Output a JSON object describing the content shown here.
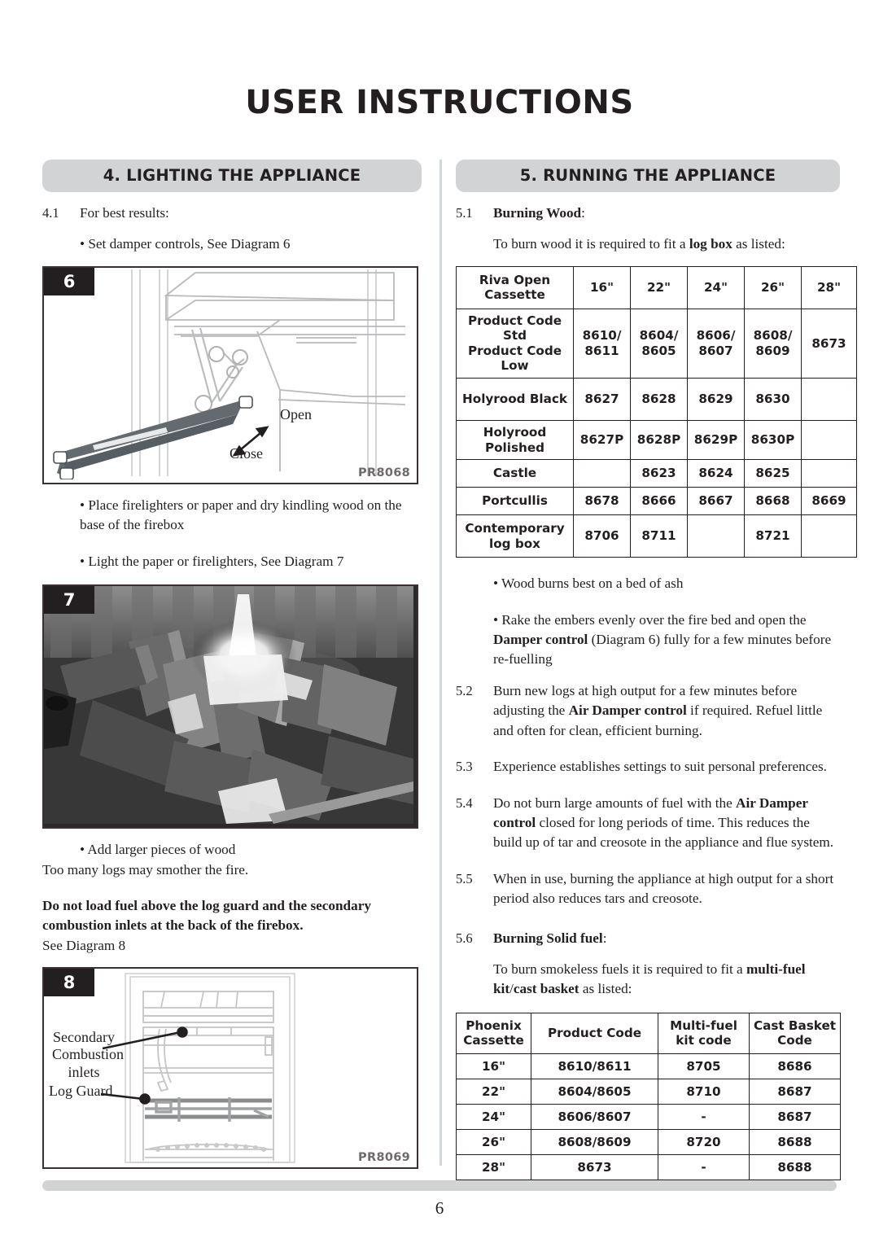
{
  "page": {
    "title": "USER INSTRUCTIONS",
    "number": "6"
  },
  "left_column": {
    "section_header": "4. LIGHTING THE APPLIANCE",
    "clause_4_1_num": "4.1",
    "clause_4_1_text": "For best results:",
    "bullet_damper": "• Set damper controls, See Diagram 6",
    "figure6": {
      "tag": "6",
      "code": "PR8068",
      "label_open": "Open",
      "label_close": "Close"
    },
    "bullet_firelighters": "• Place firelighters or paper and dry kindling wood on the base of the firebox",
    "bullet_light": "• Light the paper or firelighters, See Diagram 7",
    "figure7": {
      "tag": "7"
    },
    "bullet_add_wood": "• Add larger pieces of wood",
    "line_too_many": "Too many logs may smother the fire.",
    "warning_bold": "Do not load fuel above the log guard and the secondary combustion inlets at the back of the firebox.",
    "see_diagram_8": "See Diagram 8",
    "figure8": {
      "tag": "8",
      "code": "PR8069",
      "label_secondary": "Secondary\nCombustion\ninlets",
      "label_log_guard": "Log Guard"
    }
  },
  "right_column": {
    "section_header": "5. RUNNING THE APPLIANCE",
    "clause_5_1_num": "5.1",
    "clause_5_1_bold": "Burning Wood",
    "clause_5_1_colon": ":",
    "logbox_intro_a": "To burn wood it is required to fit a ",
    "logbox_intro_b": "log box",
    "logbox_intro_c": " as listed:",
    "bullet_bed_of_ash": "• Wood burns best on a bed of ash",
    "bullet_rake_a": "• Rake the embers evenly over the fire bed and open the ",
    "bullet_rake_b": "Damper control",
    "bullet_rake_c": " (Diagram 6) fully for a few minutes before re-fuelling",
    "clause_5_2_num": "5.2",
    "clause_5_2_a": "Burn new logs at high output for a few minutes before adjusting the ",
    "clause_5_2_b": "Air Damper control",
    "clause_5_2_c": " if required. Refuel little and often for clean, efficient burning.",
    "clause_5_3_num": "5.3",
    "clause_5_3_text": "Experience establishes settings to suit personal preferences.",
    "clause_5_4_num": "5.4",
    "clause_5_4_a": "Do not burn large amounts of fuel with the ",
    "clause_5_4_b": "Air Damper control",
    "clause_5_4_c": " closed for long periods of time. This reduces the build up of tar and creosote in the appliance and flue system.",
    "clause_5_5_num": "5.5",
    "clause_5_5_text": "When in use, burning the appliance at high output for a short period also reduces tars and creosote.",
    "clause_5_6_num": "5.6",
    "clause_5_6_bold": "Burning Solid fuel",
    "clause_5_6_colon": ":",
    "solidfuel_intro_a": "To burn smokeless fuels it is required to fit a ",
    "solidfuel_intro_b": "multi-fuel kit",
    "solidfuel_intro_c": "/",
    "solidfuel_intro_d": "cast basket",
    "solidfuel_intro_e": " as listed:"
  },
  "logbox_table": {
    "header": [
      "Riva Open\nCassette",
      "16\"",
      "22\"",
      "24\"",
      "26\"",
      "28\""
    ],
    "rows": [
      {
        "label": "Product Code Std\nProduct Code Low",
        "cells": [
          "8610/\n8611",
          "8604/\n8605",
          "8606/\n8607",
          "8608/\n8609",
          "8673"
        ]
      },
      {
        "label": "Holyrood Black",
        "cells": [
          "8627",
          "8628",
          "8629",
          "8630",
          ""
        ]
      },
      {
        "label": "Holyrood Polished",
        "cells": [
          "8627P",
          "8628P",
          "8629P",
          "8630P",
          ""
        ]
      },
      {
        "label": "Castle",
        "cells": [
          "",
          "8623",
          "8624",
          "8625",
          ""
        ]
      },
      {
        "label": "Portcullis",
        "cells": [
          "8678",
          "8666",
          "8667",
          "8668",
          "8669"
        ]
      },
      {
        "label": "Contemporary\nlog box",
        "cells": [
          "8706",
          "8711",
          "",
          "8721",
          ""
        ]
      }
    ]
  },
  "multifuel_table": {
    "header": [
      "Phoenix\nCassette",
      "Product Code",
      "Multi-fuel\nkit code",
      "Cast Basket\nCode"
    ],
    "rows": [
      [
        "16\"",
        "8610/8611",
        "8705",
        "8686"
      ],
      [
        "22\"",
        "8604/8605",
        "8710",
        "8687"
      ],
      [
        "24\"",
        "8606/8607",
        "-",
        "8687"
      ],
      [
        "26\"",
        "8608/8609",
        "8720",
        "8688"
      ],
      [
        "28\"",
        "8673",
        "-",
        "8688"
      ]
    ]
  },
  "colors": {
    "pill": "#d2d3d5",
    "tag": "#231f20",
    "divider": "#d3d8da",
    "text": "#231f20"
  }
}
